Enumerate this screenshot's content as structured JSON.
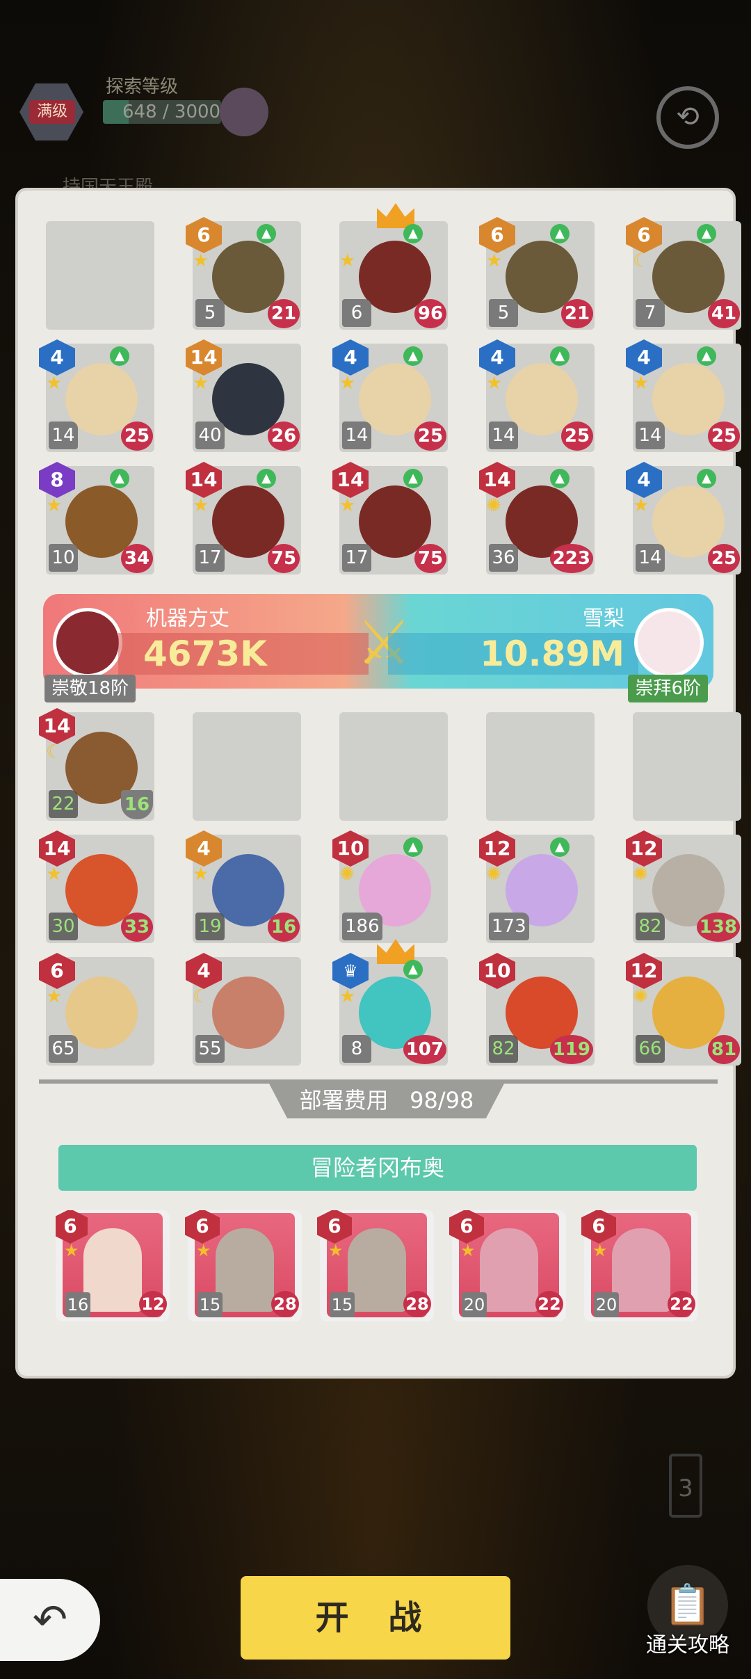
{
  "hud": {
    "level_badge": "满级",
    "title": "探索等级",
    "exp_text": "648 / 3000",
    "exp_fraction": 0.216,
    "sub_text": "持国天王殿"
  },
  "top_grid": [
    {
      "empty": true
    },
    {
      "level": "6",
      "level_color": "orange",
      "star": "star",
      "upgrade": true,
      "bl": "5",
      "br": "21",
      "art": "#6a5a3a"
    },
    {
      "level": "",
      "crown": true,
      "star": "star",
      "upgrade": true,
      "bl": "6",
      "br": "96",
      "art": "#7a2a24"
    },
    {
      "level": "6",
      "level_color": "orange",
      "star": "star",
      "upgrade": true,
      "bl": "5",
      "br": "21",
      "art": "#6a5a3a"
    },
    {
      "level": "6",
      "level_color": "orange",
      "star": "moon",
      "upgrade": true,
      "bl": "7",
      "br": "41",
      "art": "#6a5a3a"
    },
    {
      "level": "4",
      "level_color": "blue",
      "star": "star",
      "upgrade": true,
      "bl": "14",
      "br": "25",
      "art": "#e8d2a8"
    },
    {
      "level": "14",
      "level_color": "orange",
      "star": "star",
      "upgrade": false,
      "bl": "40",
      "br": "26",
      "art": "#2e3440"
    },
    {
      "level": "4",
      "level_color": "blue",
      "star": "star",
      "upgrade": true,
      "bl": "14",
      "br": "25",
      "art": "#e8d2a8"
    },
    {
      "level": "4",
      "level_color": "blue",
      "star": "star",
      "upgrade": true,
      "bl": "14",
      "br": "25",
      "art": "#e8d2a8"
    },
    {
      "level": "4",
      "level_color": "blue",
      "star": "star",
      "upgrade": true,
      "bl": "14",
      "br": "25",
      "art": "#e8d2a8"
    },
    {
      "level": "8",
      "level_color": "purple",
      "star": "star",
      "upgrade": true,
      "bl": "10",
      "br": "34",
      "art": "#8a5a28"
    },
    {
      "level": "14",
      "level_color": "red",
      "star": "star",
      "upgrade": true,
      "bl": "17",
      "br": "75",
      "art": "#7a2a24"
    },
    {
      "level": "14",
      "level_color": "red",
      "star": "star",
      "upgrade": true,
      "bl": "17",
      "br": "75",
      "art": "#7a2a24"
    },
    {
      "level": "14",
      "level_color": "red",
      "star": "sun",
      "upgrade": true,
      "bl": "36",
      "br": "223",
      "art": "#7a2a24"
    },
    {
      "level": "4",
      "level_color": "blue",
      "star": "star",
      "upgrade": true,
      "bl": "14",
      "br": "25",
      "art": "#e8d2a8"
    }
  ],
  "versus": {
    "left_name": "机器方丈",
    "left_power": "4673K",
    "left_rank": "崇敬18阶",
    "right_name": "雪梨",
    "right_power": "10.89M",
    "right_rank": "崇拜6阶"
  },
  "bottom_grid": [
    {
      "level": "14",
      "level_color": "red",
      "star": "moon",
      "upgrade": false,
      "bl": "22",
      "br": "16",
      "green": true,
      "shield": true,
      "art": "#8a5a30"
    },
    {
      "empty": true
    },
    {
      "empty": true
    },
    {
      "empty": true
    },
    {
      "empty": true
    },
    {
      "level": "14",
      "level_color": "red",
      "star": "star",
      "upgrade": false,
      "bl": "30",
      "br": "33",
      "green": true,
      "art": "#d8542a"
    },
    {
      "level": "4",
      "level_color": "orange",
      "star": "star",
      "upgrade": false,
      "bl": "19",
      "br": "16",
      "green": true,
      "art": "#4a6aa8"
    },
    {
      "level": "10",
      "level_color": "red",
      "star": "sun",
      "upgrade": true,
      "bl": "186",
      "br": "",
      "art": "#e6a8d8"
    },
    {
      "level": "12",
      "level_color": "red",
      "star": "sun",
      "upgrade": true,
      "bl": "173",
      "br": "",
      "art": "#c8a8e6"
    },
    {
      "level": "12",
      "level_color": "red",
      "star": "sun",
      "upgrade": false,
      "bl": "82",
      "br": "138",
      "green": true,
      "art": "#b8b0a4"
    },
    {
      "level": "6",
      "level_color": "red",
      "star": "star",
      "upgrade": false,
      "bl": "65",
      "br": "",
      "art": "#e6c88a"
    },
    {
      "level": "4",
      "level_color": "red",
      "star": "moon",
      "upgrade": false,
      "bl": "55",
      "br": "",
      "art": "#c8806a"
    },
    {
      "level": "♛",
      "level_color": "crown",
      "crown": true,
      "star": "star",
      "upgrade": true,
      "bl": "8",
      "br": "107",
      "art": "#42c4c0"
    },
    {
      "level": "10",
      "level_color": "red",
      "star": "",
      "upgrade": false,
      "bl": "82",
      "br": "119",
      "green": true,
      "art": "#d84a2a"
    },
    {
      "level": "12",
      "level_color": "red",
      "star": "sun",
      "upgrade": false,
      "bl": "66",
      "br": "81",
      "green": true,
      "art": "#e6b040"
    }
  ],
  "deploy": {
    "label": "部署费用",
    "value": "98/98"
  },
  "adventurer_title": "冒险者冈布奥",
  "cards": [
    {
      "level": "6",
      "bl": "16",
      "br": "12",
      "fig": "#f0d8cc"
    },
    {
      "level": "6",
      "bl": "15",
      "br": "28",
      "fig": "#b8aca0"
    },
    {
      "level": "6",
      "bl": "15",
      "br": "28",
      "fig": "#b8aca0"
    },
    {
      "level": "6",
      "bl": "20",
      "br": "22",
      "fig": "#e0a0b0"
    },
    {
      "level": "6",
      "bl": "20",
      "br": "22",
      "fig": "#e0a0b0"
    }
  ],
  "battery_value": "3",
  "buttons": {
    "back_icon": "↶",
    "start": "开 战",
    "guide_label": "通关攻略",
    "guide_icon": "📋"
  },
  "icons": {
    "hud_right": "⟲",
    "swords": "⚔",
    "star": "★",
    "moon": "☾",
    "sun": "✺",
    "upgrade": "▲"
  }
}
